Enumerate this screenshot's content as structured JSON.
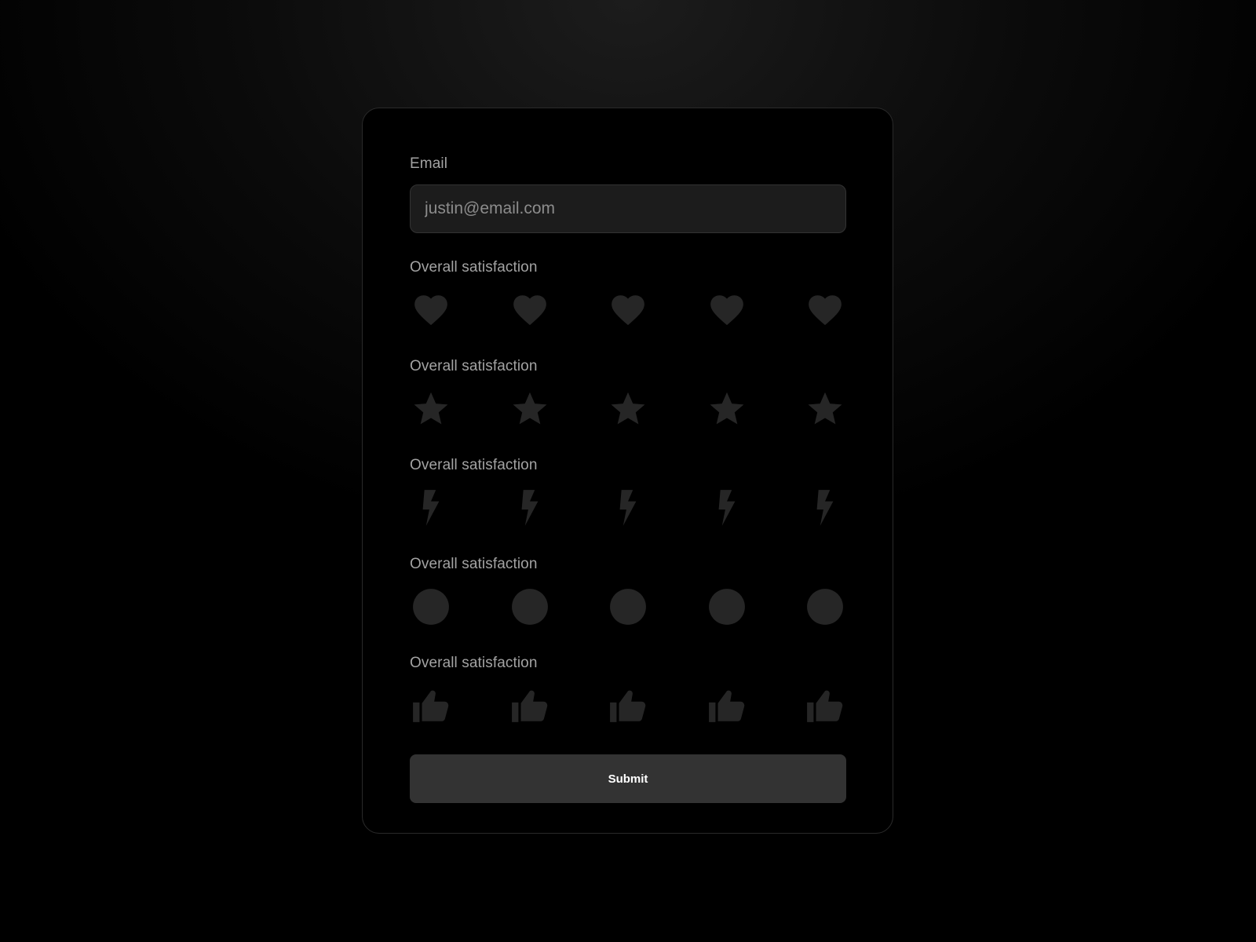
{
  "form": {
    "email": {
      "label": "Email",
      "placeholder": "justin@email.com",
      "value": ""
    },
    "ratings": [
      {
        "label": "Overall satisfaction",
        "icon": "heart-icon",
        "count": 5,
        "selected": 0
      },
      {
        "label": "Overall satisfaction",
        "icon": "star-icon",
        "count": 5,
        "selected": 0
      },
      {
        "label": "Overall satisfaction",
        "icon": "bolt-icon",
        "count": 5,
        "selected": 0
      },
      {
        "label": "Overall satisfaction",
        "icon": "circle-icon",
        "count": 5,
        "selected": 0
      },
      {
        "label": "Overall satisfaction",
        "icon": "thumbs-up-icon",
        "count": 5,
        "selected": 0
      }
    ],
    "submit_label": "Submit"
  },
  "colors": {
    "icon_inactive": "#262626",
    "card_background": "#000000",
    "card_border": "#2a2a2a",
    "input_background": "#1c1c1c",
    "button_background": "#333333",
    "label_text": "#a3a3a3",
    "button_text": "#ffffff"
  }
}
